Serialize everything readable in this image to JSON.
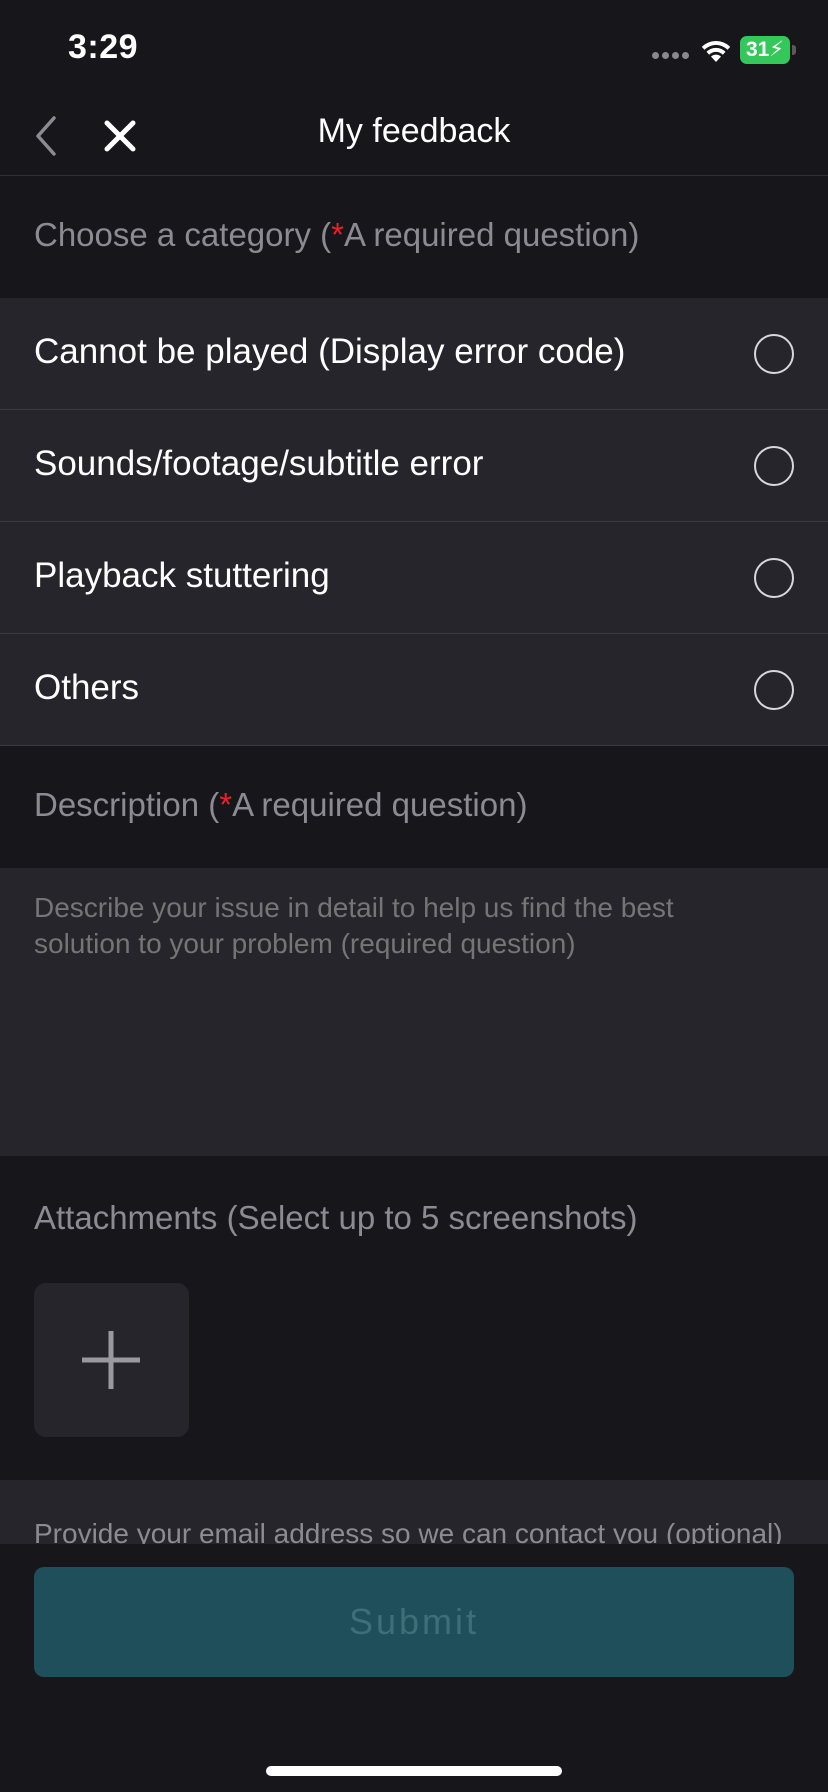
{
  "status_bar": {
    "time": "3:29",
    "battery_level": "31",
    "battery_charging": true,
    "battery_color": "#34c759"
  },
  "nav": {
    "title": "My feedback",
    "back_icon": "chevron-left-icon",
    "close_icon": "close-icon"
  },
  "category_section": {
    "header_prefix": "Choose a category (",
    "required_star": "*",
    "header_suffix": "A required question)",
    "options": [
      {
        "label": "Cannot be played (Display error code)",
        "selected": false
      },
      {
        "label": "Sounds/footage/subtitle error",
        "selected": false
      },
      {
        "label": "Playback stuttering",
        "selected": false
      },
      {
        "label": "Others",
        "selected": false
      }
    ]
  },
  "description_section": {
    "header_prefix": "Description (",
    "required_star": "*",
    "header_suffix": "A required question)",
    "placeholder": "Describe your issue in detail to help us find the best solution to your problem (required question)",
    "value": ""
  },
  "attachments_section": {
    "header": "Attachments (Select up to 5 screenshots)",
    "add_icon": "plus-icon"
  },
  "email_section": {
    "label": "Provide your email address so we can contact you (optional)"
  },
  "submit": {
    "label": "Submit",
    "enabled": false,
    "color": "#1f4f5a"
  },
  "colors": {
    "background": "#17161b",
    "panel": "#26252c",
    "required": "#e8202a",
    "muted_text": "#8c8b91"
  }
}
